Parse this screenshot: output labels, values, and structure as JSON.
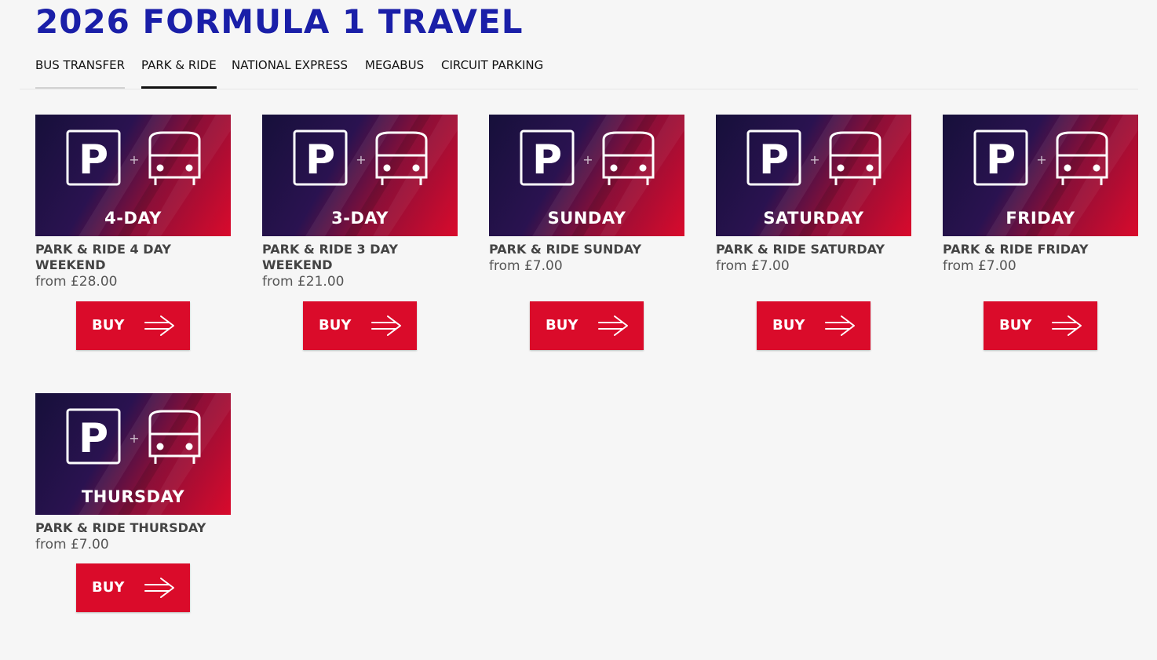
{
  "header": {
    "title": "2026 FORMULA 1 TRAVEL"
  },
  "tabs": [
    {
      "label": "BUS TRANSFER"
    },
    {
      "label": "PARK & RIDE"
    },
    {
      "label": "NATIONAL EXPRESS"
    },
    {
      "label": "MEGABUS"
    },
    {
      "label": "CIRCUIT PARKING"
    }
  ],
  "active_tab": "PARK & RIDE",
  "colors": {
    "title": "#1a1fa8",
    "buy_button": "#da0b2a",
    "banner_dark": "#16103a",
    "banner_red": "#d90a2c"
  },
  "icons": [
    "parking-icon",
    "bus-icon",
    "arrow-right-icon"
  ],
  "products": [
    {
      "banner": "4-DAY",
      "name": "PARK & RIDE 4 DAY WEEKEND",
      "price": "from £28.00",
      "button": "BUY"
    },
    {
      "banner": "3-DAY",
      "name": "PARK & RIDE 3 DAY WEEKEND",
      "price": "from £21.00",
      "button": "BUY"
    },
    {
      "banner": "SUNDAY",
      "name": "PARK & RIDE SUNDAY",
      "price": "from £7.00",
      "button": "BUY"
    },
    {
      "banner": "SATURDAY",
      "name": "PARK & RIDE SATURDAY",
      "price": "from £7.00",
      "button": "BUY"
    },
    {
      "banner": "FRIDAY",
      "name": "PARK & RIDE FRIDAY",
      "price": "from £7.00",
      "button": "BUY"
    },
    {
      "banner": "THURSDAY",
      "name": "PARK & RIDE THURSDAY",
      "price": "from £7.00",
      "button": "BUY"
    }
  ]
}
